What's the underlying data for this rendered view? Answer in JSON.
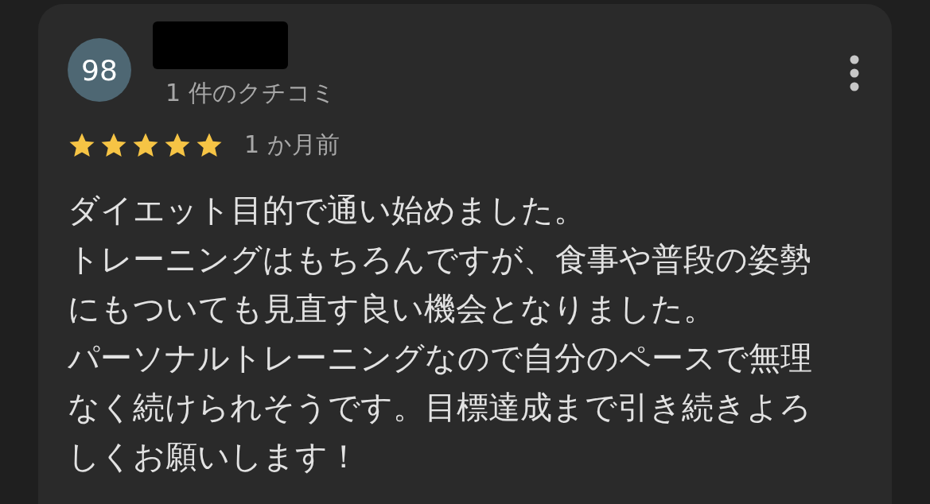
{
  "review": {
    "avatar": "98",
    "review_count": "1 件のクチコミ",
    "stars": 5,
    "time": "1 か月前",
    "paragraphs": [
      "ダイエット目的で通い始めました。",
      "トレーニングはもちろんですが、食事や普段の姿勢にもついても見直す良い機会となりました。",
      "パーソナルトレーニングなので自分のペースで無理なく続けられそうです。目標達成まで引き続きよろしくお願いします！"
    ]
  }
}
